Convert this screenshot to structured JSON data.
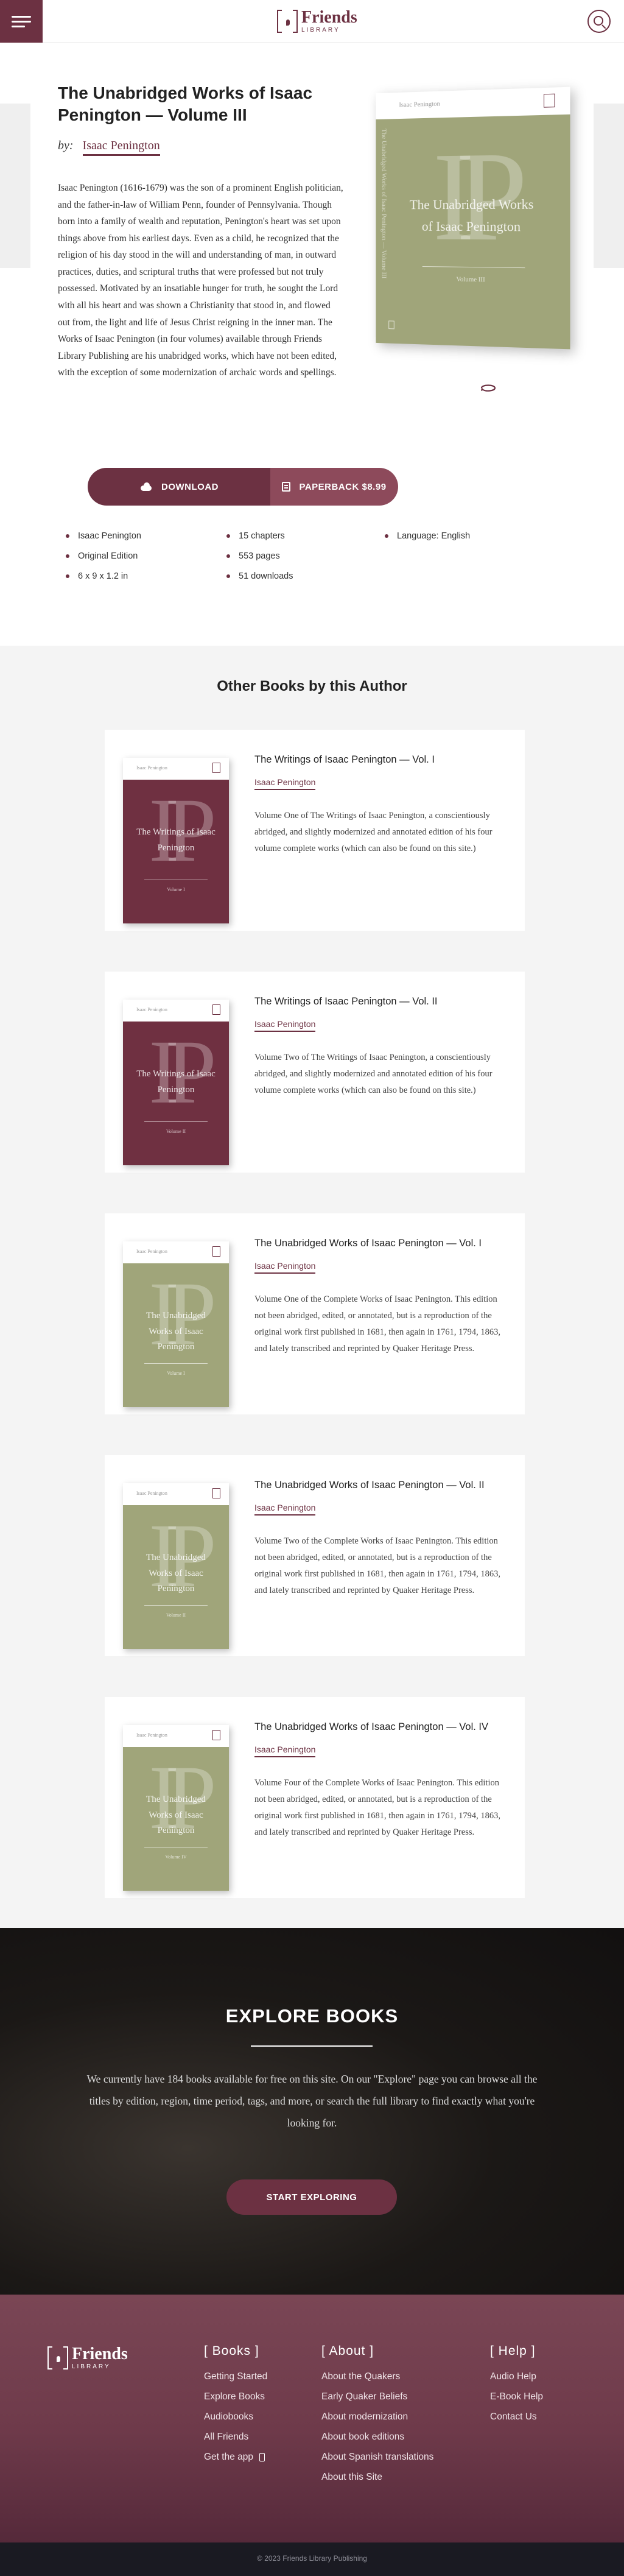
{
  "header": {
    "logo_friends": "Friends",
    "logo_library": "LIBRARY"
  },
  "book": {
    "title": "The Unabridged Works of Isaac Penington — Volume III",
    "by_label": "by:",
    "author": "Isaac Penington",
    "description": "Isaac Penington (1616-1679) was the son of a prominent English politician, and the father-in-law of William Penn, founder of Pennsylvania. Though born into a family of wealth and reputation, Penington's heart was set upon things above from his earliest days. Even as a child, he recognized that the religion of his day stood in the will and understanding of man, in outward practices, duties, and scriptural truths that were professed but not truly possessed. Motivated by an insatiable hunger for truth, he sought the Lord with all his heart and was shown a Christianity that stood in, and flowed out from, the light and life of Jesus Christ reigning in the inner man. The Works of Isaac Penington (in four volumes) available through Friends Library Publishing are his unabridged works, which have not been edited, with the exception of some modernization of archaic words and spellings.",
    "cover": {
      "strip_text": "Isaac Penington",
      "letter": "IP",
      "title": "The Unabridged Works of Isaac Penington",
      "spine_text": "The Unabridged Works of Isaac Penington — Volume III",
      "volume": "Volume III",
      "color": "#a0a57a"
    },
    "download_label": "DOWNLOAD",
    "paperback_label": "PAPERBACK $8.99",
    "meta": {
      "col1": [
        "Isaac Penington",
        "Original Edition",
        "6 x 9 x 1.2 in"
      ],
      "col2": [
        "15 chapters",
        "553 pages",
        "51 downloads"
      ],
      "col3": [
        "Language: English"
      ]
    }
  },
  "other_books": {
    "heading": "Other Books by this Author",
    "items": [
      {
        "title": "The Writings of Isaac Penington — Vol. I",
        "author": "Isaac Penington",
        "description": "Volume One of The Writings of Isaac Penington, a conscientiously abridged, and slightly modernized and annotated edition of his four volume complete works (which can also be found on this site.)",
        "cover_title": "The Writings of Isaac Penington",
        "cover_volume": "Volume I",
        "cover_color": "#6f3041"
      },
      {
        "title": "The Writings of Isaac Penington — Vol. II",
        "author": "Isaac Penington",
        "description": "Volume Two of The Writings of Isaac Penington, a conscientiously abridged, and slightly modernized and annotated edition of his four volume complete works (which can also be found on this site.)",
        "cover_title": "The Writings of Isaac Penington",
        "cover_volume": "Volume II",
        "cover_color": "#6f3041"
      },
      {
        "title": "The Unabridged Works of Isaac Penington — Vol. I",
        "author": "Isaac Penington",
        "description": "Volume One of the Complete Works of Isaac Penington. This edition not been abridged, edited, or annotated, but is a reproduction of the original work first published in 1681, then again in 1761, 1794, 1863, and lately transcribed and reprinted by Quaker Heritage Press.",
        "cover_title": "The Unabridged Works of Isaac Penington",
        "cover_volume": "Volume I",
        "cover_color": "#a0a57a"
      },
      {
        "title": "The Unabridged Works of Isaac Penington — Vol. II",
        "author": "Isaac Penington",
        "description": "Volume Two of the Complete Works of Isaac Penington. This edition not been abridged, edited, or annotated, but is a reproduction of the original work first published in 1681, then again in 1761, 1794, 1863, and lately transcribed and reprinted by Quaker Heritage Press.",
        "cover_title": "The Unabridged Works of Isaac Penington",
        "cover_volume": "Volume II",
        "cover_color": "#a0a57a"
      },
      {
        "title": "The Unabridged Works of Isaac Penington — Vol. IV",
        "author": "Isaac Penington",
        "description": "Volume Four of the Complete Works of Isaac Penington. This edition not been abridged, edited, or annotated, but is a reproduction of the original work first published in 1681, then again in 1761, 1794, 1863, and lately transcribed and reprinted by Quaker Heritage Press.",
        "cover_title": "The Unabridged Works of Isaac Penington",
        "cover_volume": "Volume IV",
        "cover_color": "#a0a57a"
      }
    ]
  },
  "explore": {
    "title": "EXPLORE BOOKS",
    "text": "We currently have 184 books available for free on this site. On our \"Explore\" page you can browse all the titles by edition, region, time period, tags, and more, or search the full library to find exactly what you're looking for.",
    "button": "START EXPLORING"
  },
  "footer": {
    "logo_friends": "Friends",
    "logo_library": "LIBRARY",
    "columns": [
      {
        "title": "[ Books ]",
        "links": [
          "Getting Started",
          "Explore Books",
          "Audiobooks",
          "All Friends",
          "Get the app"
        ]
      },
      {
        "title": "[ About ]",
        "links": [
          "About the Quakers",
          "Early Quaker Beliefs",
          "About modernization",
          "About book editions",
          "About Spanish translations",
          "About this Site"
        ]
      },
      {
        "title": "[ Help ]",
        "links": [
          "Audio Help",
          "E-Book Help",
          "Contact Us"
        ]
      }
    ],
    "copyright": "© 2023 Friends Library Publishing"
  },
  "colors": {
    "brand": "#6c3142",
    "olive_cover": "#a0a57a",
    "maroon_cover": "#6f3041"
  }
}
